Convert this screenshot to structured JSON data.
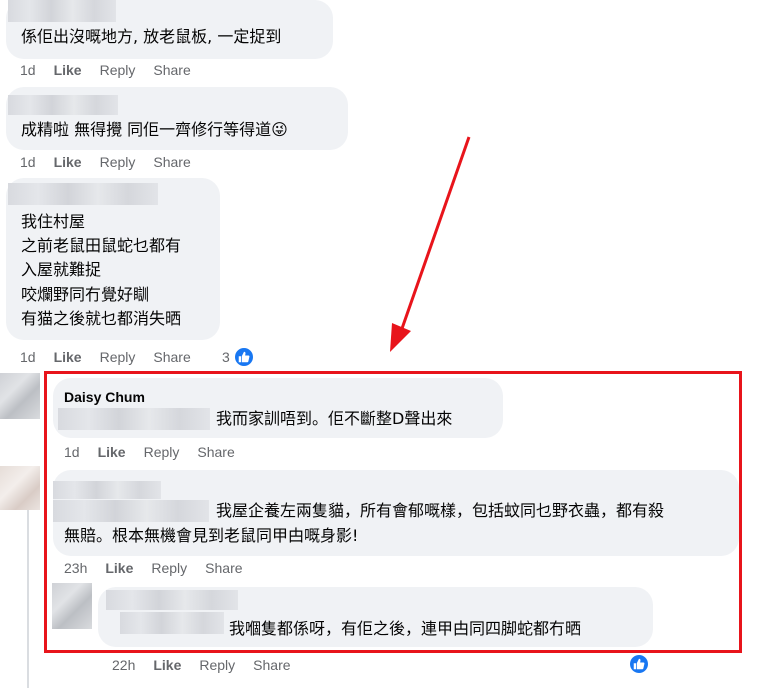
{
  "comments": [
    {
      "id": "c1",
      "text": "係佢出沒嘅地方, 放老鼠板, 一定捉到",
      "time": "1d",
      "like": "Like",
      "reply": "Reply",
      "share": "Share"
    },
    {
      "id": "c2",
      "text": "成精啦 無得攪 同佢一齊修行等得道😜",
      "time": "1d",
      "like": "Like",
      "reply": "Reply",
      "share": "Share"
    },
    {
      "id": "c3",
      "lines": [
        "我住村屋",
        "之前老鼠田鼠蛇乜都有",
        "入屋就難捉",
        "咬爛野同冇覺好瞓",
        "有猫之後就乜都消失晒"
      ],
      "time": "1d",
      "like": "Like",
      "reply": "Reply",
      "share": "Share",
      "reactions": "3"
    }
  ],
  "replies": [
    {
      "id": "r1",
      "author": "Daisy Chum",
      "text": "我而家訓唔到。佢不斷整D聲出來",
      "time": "1d",
      "like": "Like",
      "reply": "Reply",
      "share": "Share"
    },
    {
      "id": "r2",
      "line1": "我屋企養左兩隻貓，所有會郁嘅樣，包括蚊同乜野衣蟲，都有殺",
      "line2": "無賠。根本無機會見到老鼠同甲甴嘅身影!",
      "time": "23h",
      "like": "Like",
      "reply": "Reply",
      "share": "Share"
    },
    {
      "id": "r3",
      "text": "我嗰隻都係呀，有佢之後，連甲甴同四脚蛇都冇晒",
      "time": "22h",
      "like": "Like",
      "reply": "Reply",
      "share": "Share"
    }
  ],
  "colors": {
    "highlight": "#e8141b",
    "arrow": "#e8141b",
    "like_blue": "#1877f2",
    "bubble": "#f0f2f5",
    "meta": "#65676b"
  },
  "icons": {
    "reaction": "like-thumb-icon"
  }
}
